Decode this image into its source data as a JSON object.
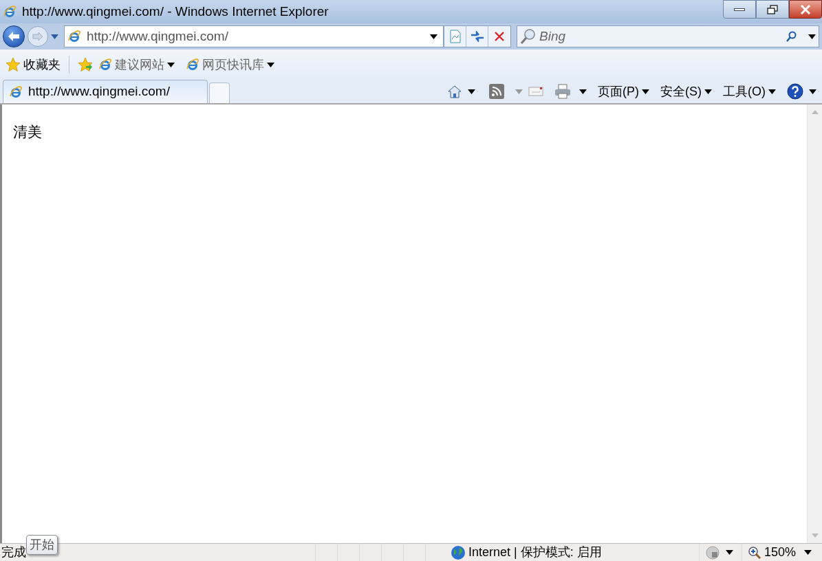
{
  "window": {
    "title": "http://www.qingmei.com/ - Windows Internet Explorer"
  },
  "address_bar": {
    "url": "http://www.qingmei.com/"
  },
  "search": {
    "placeholder": "Bing"
  },
  "favorites_bar": {
    "favorites_label": "收藏夹",
    "links": [
      {
        "label": "建议网站"
      },
      {
        "label": "网页快讯库"
      }
    ]
  },
  "tabs": [
    {
      "label": "http://www.qingmei.com/",
      "selected": true
    }
  ],
  "command_bar": {
    "menus": [
      "页面(P)",
      "安全(S)",
      "工具(O)"
    ]
  },
  "page": {
    "text": "清美"
  },
  "tooltip": {
    "text": "开始"
  },
  "status_bar": {
    "status": "完成",
    "zone": "Internet | 保护模式: 启用",
    "zoom": "150%"
  }
}
